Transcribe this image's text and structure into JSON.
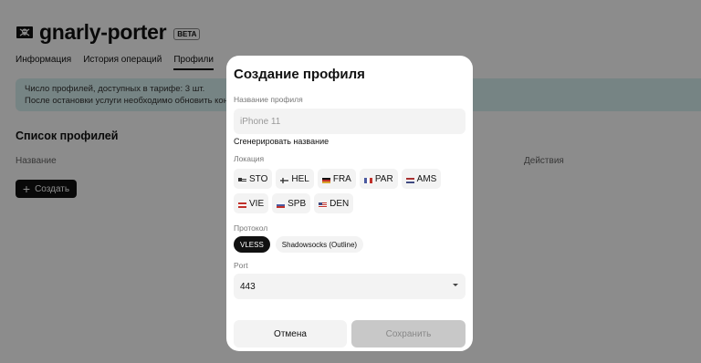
{
  "app": {
    "logo_icon": "pirate-flag-icon",
    "name": "gnarly-porter",
    "badge": "BETA"
  },
  "tabs": [
    {
      "label": "Информация",
      "active": false
    },
    {
      "label": "История операций",
      "active": false
    },
    {
      "label": "Профили",
      "active": true
    }
  ],
  "info": {
    "line1": "Число профилей, доступных в тарифе: 3 шт.",
    "line2": "После остановки услуги необходимо обновить конс"
  },
  "profiles": {
    "title": "Список профилей",
    "col_name": "Название",
    "col_actions": "Действия",
    "create_label": "Создать"
  },
  "modal": {
    "title": "Создание профиля",
    "name_label": "Название профиля",
    "name_placeholder": "iPhone 11",
    "generate_label": "Сгенерировать название",
    "location_label": "Локация",
    "locations": [
      {
        "code": "STO",
        "flag": "flag-se"
      },
      {
        "code": "HEL",
        "flag": "flag-fi"
      },
      {
        "code": "FRA",
        "flag": "flag-de"
      },
      {
        "code": "PAR",
        "flag": "flag-fr"
      },
      {
        "code": "AMS",
        "flag": "flag-nl"
      },
      {
        "code": "VIE",
        "flag": "flag-at"
      },
      {
        "code": "SPB",
        "flag": "flag-ru"
      },
      {
        "code": "DEN",
        "flag": "flag-us"
      }
    ],
    "protocol_label": "Протокол",
    "protocols": [
      {
        "label": "VLESS",
        "selected": true
      },
      {
        "label": "Shadowsocks (Outline)",
        "selected": false
      }
    ],
    "port_label": "Port",
    "port_value": "443",
    "cancel_label": "Отмена",
    "save_label": "Сохранить"
  }
}
